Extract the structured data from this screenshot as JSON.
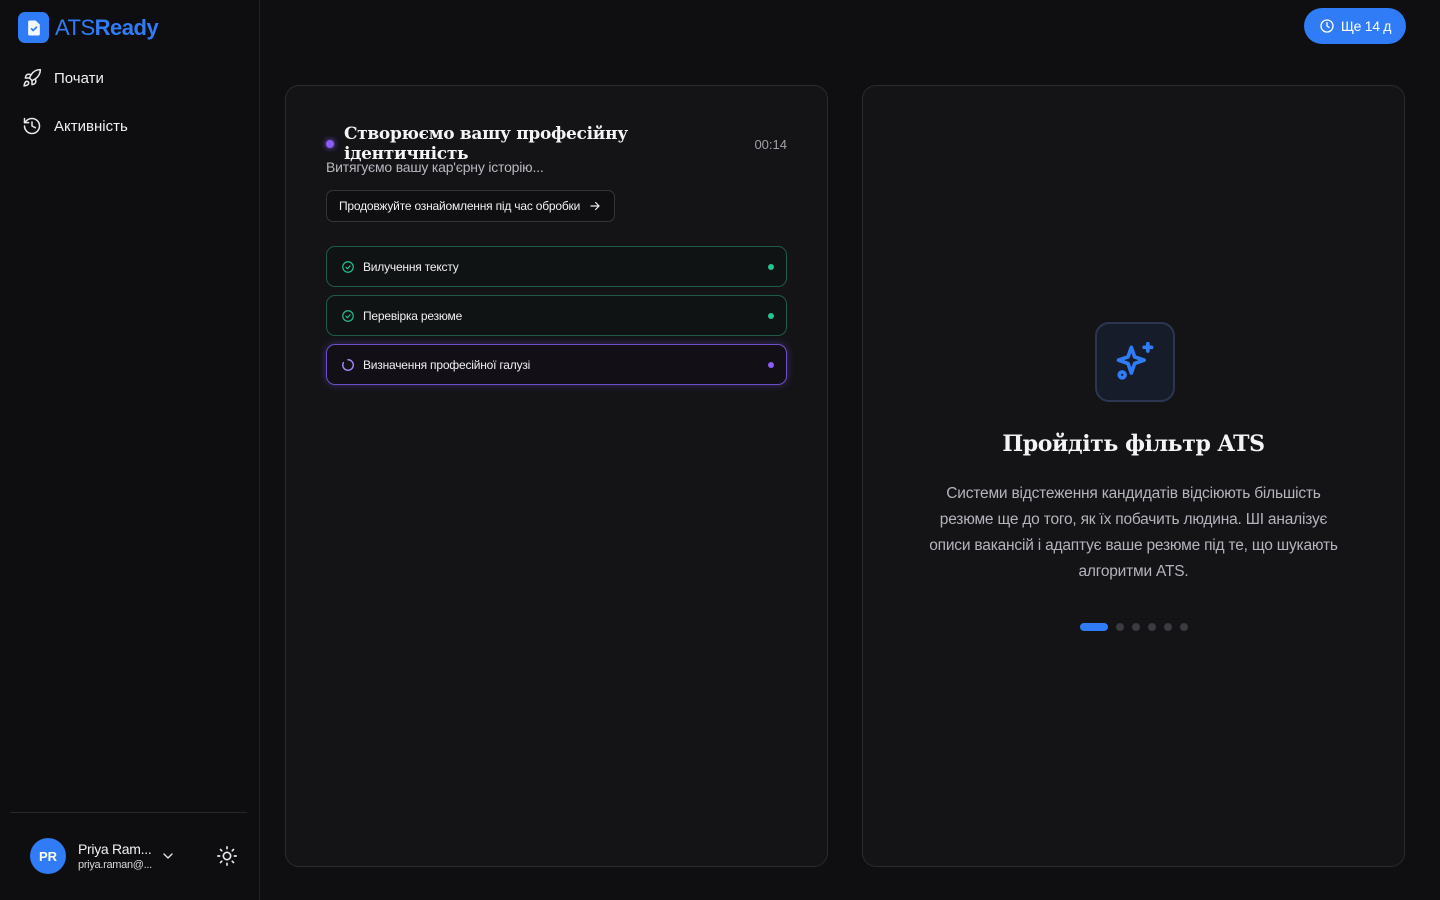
{
  "brand": {
    "name_part1": "ATS",
    "name_part2": "Ready",
    "color": "#2f7cf6"
  },
  "sidebar": {
    "items": [
      {
        "label": "Почати",
        "icon": "rocket-icon"
      },
      {
        "label": "Активність",
        "icon": "history-icon"
      }
    ]
  },
  "user": {
    "initials": "PR",
    "name": "Priya Ram...",
    "email": "priya.raman@..."
  },
  "trial": {
    "label": "Ще 14 д",
    "icon": "clock-icon"
  },
  "processing": {
    "title": "Створюємо вашу професійну ідентичність",
    "timer": "00:14",
    "subtitle": "Витягуємо вашу кар'єрну історію...",
    "continue_label": "Продовжуйте ознайомлення під час обробки",
    "steps": [
      {
        "label": "Вилучення тексту",
        "status": "done"
      },
      {
        "label": "Перевірка резюме",
        "status": "done"
      },
      {
        "label": "Визначення професійної галузі",
        "status": "active"
      }
    ]
  },
  "feature": {
    "icon": "sparkles-icon",
    "title": "Пройдіть фільтр ATS",
    "text": "Системи відстеження кандидатів відсіюють більшість резюме ще до того, як їх побачить людина. ШІ аналізує описи вакансій і адаптує ваше резюме під те, що шукають алгоритми ATS.",
    "slides_total": 6,
    "slide_active": 1
  },
  "colors": {
    "accent": "#2f7cf6",
    "success": "#22c58b",
    "progress": "#8b5cf6"
  }
}
